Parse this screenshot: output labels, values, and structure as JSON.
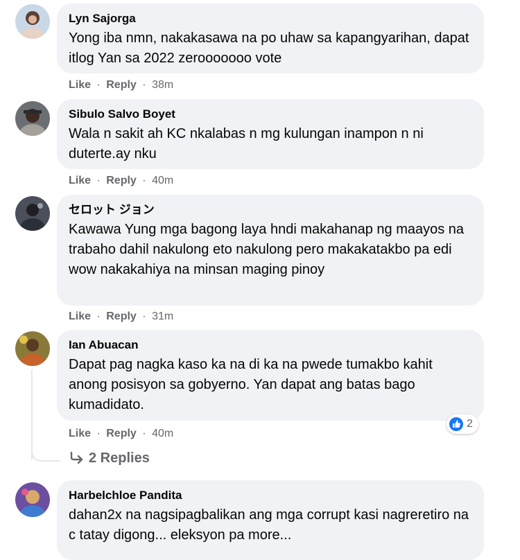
{
  "comments": [
    {
      "author": "Lyn Sajorga",
      "text": "Yong iba nmn, nakakasawa na po uhaw sa kapangyarihan, dapat itlog Yan sa 2022 zerooooooo vote",
      "like": "Like",
      "reply": "Reply",
      "sep": "·",
      "time": "38m"
    },
    {
      "author": "Sibulo Salvo Boyet",
      "text": "Wala n sakit ah KC nkalabas n mg kulungan inampon n ni duterte.ay nku",
      "like": "Like",
      "reply": "Reply",
      "sep": "·",
      "time": "40m"
    },
    {
      "author": "セロット ジョン",
      "text": "Kawawa Yung mga bagong laya hndi makahanap ng maayos na trabaho dahil nakulong eto nakulong pero makakatakbo pa edi wow nakakahiya na minsan maging pinoy",
      "like": "Like",
      "reply": "Reply",
      "sep": "·",
      "time": "31m"
    },
    {
      "author": "Ian Abuacan",
      "text": "Dapat pag nagka kaso ka na di ka na pwede tumakbo kahit anong posisyon sa gobyerno. Yan dapat ang batas bago kumadidato.",
      "like": "Like",
      "reply": "Reply",
      "sep": "·",
      "time": "40m",
      "reaction_count": "2",
      "replies_label": "2 Replies"
    },
    {
      "author": "Harbelchloe Pandita",
      "text": "dahan2x na nagsipagbalikan ang mga corrupt kasi nagreretiro na c tatay digong... eleksyon pa more..."
    }
  ],
  "colors": {
    "bubble": "#f0f2f5",
    "text": "#050505",
    "meta": "#65676b",
    "like_blue": "#1877f2"
  },
  "icons": {
    "reaction": "like-reaction-icon",
    "reply_arrow": "reply-arrow-icon"
  }
}
